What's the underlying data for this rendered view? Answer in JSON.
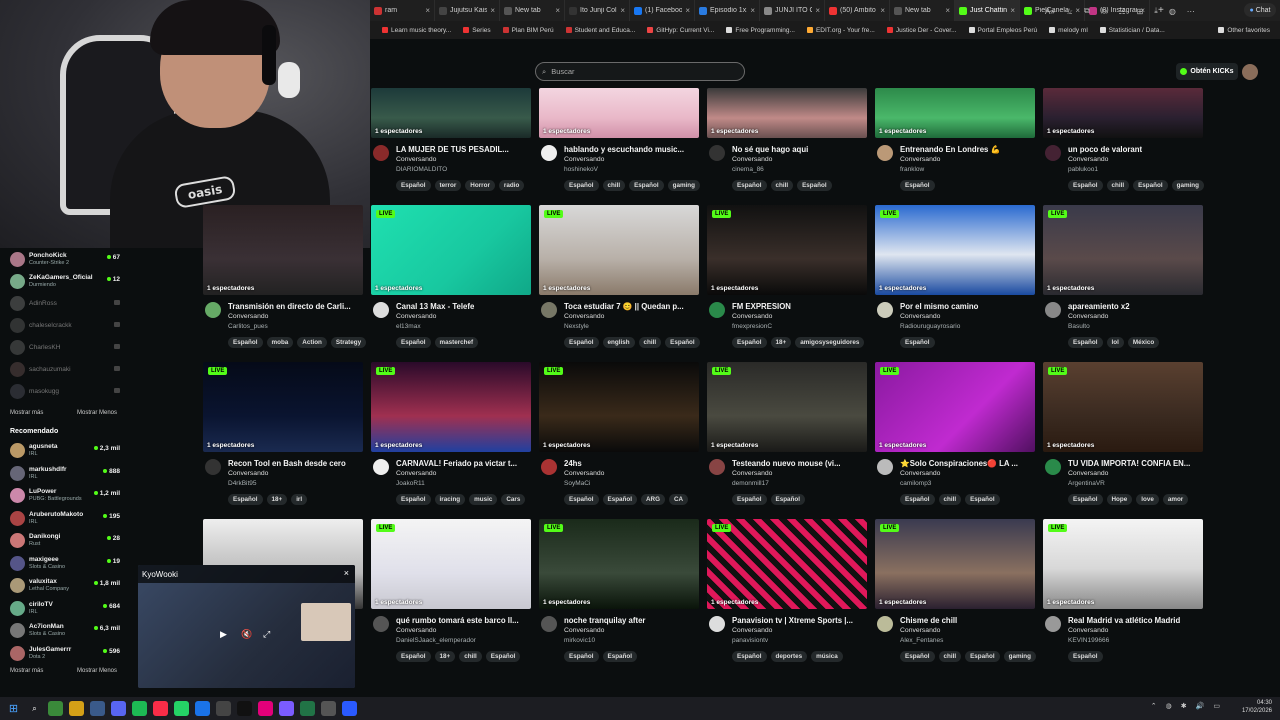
{
  "browser": {
    "tabs": [
      {
        "label": "ram",
        "color": "#c33"
      },
      {
        "label": "Jujutsu Kaisen",
        "color": "#444"
      },
      {
        "label": "New tab",
        "color": "#555"
      },
      {
        "label": "Ito Junji Coll",
        "color": "#333"
      },
      {
        "label": "(1) Facebook",
        "color": "#1877f2"
      },
      {
        "label": "Episodio 1x1",
        "color": "#2a7be0"
      },
      {
        "label": "JUNJI ITO CO",
        "color": "#888"
      },
      {
        "label": "(50) Ambito",
        "color": "#e33"
      },
      {
        "label": "New tab",
        "color": "#555"
      },
      {
        "label": "Just Chatting",
        "color": "#53fc18",
        "active": true
      },
      {
        "label": "PielCanela_21",
        "color": "#53fc18"
      },
      {
        "label": "(3) Instagram",
        "color": "#c13584"
      }
    ],
    "new_tab_symbol": "+",
    "window_controls": [
      "–",
      "▢",
      "✕"
    ],
    "chat_button": "Chat",
    "bookmarks": [
      {
        "label": "Learn music theory...",
        "color": "#e33"
      },
      {
        "label": "Series",
        "color": "#e33"
      },
      {
        "label": "Plan BIM Perú",
        "color": "#c33"
      },
      {
        "label": "Student and Educa...",
        "color": "#c33"
      },
      {
        "label": "GitHyp: Current Vi...",
        "color": "#e44"
      },
      {
        "label": "Free Programming...",
        "color": "#ddd"
      },
      {
        "label": "EDIT.org - Your fre...",
        "color": "#fa3"
      },
      {
        "label": "Justice Der - Cover...",
        "color": "#e33"
      },
      {
        "label": "Portal Empleos Perú",
        "color": "#ddd"
      },
      {
        "label": "melody ml",
        "color": "#ddd"
      },
      {
        "label": "Statistician / Data...",
        "color": "#ddd"
      }
    ],
    "other_favorites": "Other favorites"
  },
  "header": {
    "search_placeholder": "Buscar",
    "get_kicks_label": "Obtén KICKs"
  },
  "sidebar": {
    "following": [
      {
        "name": "PonchoKick",
        "category": "Counter-Strike 2",
        "viewers": "67",
        "color": "#a78",
        "online": true
      },
      {
        "name": "ZeKaGamers_Oficial",
        "category": "Durmiendo",
        "viewers": "12",
        "color": "#7a8",
        "online": true
      },
      {
        "name": "AdinRoss",
        "online": false,
        "color": "#999"
      },
      {
        "name": "chaleselcrackk",
        "online": false,
        "color": "#777"
      },
      {
        "name": "CharlesKH",
        "online": false,
        "color": "#888"
      },
      {
        "name": "sachauzumaki",
        "online": false,
        "color": "#866"
      },
      {
        "name": "masokugg",
        "online": false,
        "color": "#667"
      }
    ],
    "show_more": "Mostrar más",
    "show_less": "Mostrar Menos",
    "recommended_title": "Recomendado",
    "recommended": [
      {
        "name": "agusneta",
        "category": "IRL",
        "viewers": "2,3 mil",
        "color": "#b96"
      },
      {
        "name": "markushdlfr",
        "category": "IRL",
        "viewers": "888",
        "color": "#667"
      },
      {
        "name": "LuPower",
        "category": "PUBG: Battlegrounds",
        "viewers": "1,2 mil",
        "color": "#c8a"
      },
      {
        "name": "AruberutoMakoto",
        "category": "IRL",
        "viewers": "195",
        "color": "#a44"
      },
      {
        "name": "Danikongi",
        "category": "Rust",
        "viewers": "28",
        "color": "#c77"
      },
      {
        "name": "maxigeee",
        "category": "Slots & Casino",
        "viewers": "19",
        "color": "#558"
      },
      {
        "name": "valuxitax",
        "category": "Lethal Company",
        "viewers": "1,8 mil",
        "color": "#a97"
      },
      {
        "name": "ciriloTV",
        "category": "IRL",
        "viewers": "684",
        "color": "#6a8"
      },
      {
        "name": "Ac7ionMan",
        "category": "Slots & Casino",
        "viewers": "6,3 mil",
        "color": "#777"
      },
      {
        "name": "JulesGamerrr",
        "category": "Dota 2",
        "viewers": "596",
        "color": "#a66"
      }
    ]
  },
  "live_badge": "LIVE",
  "streams": [
    {
      "title": "LA MUJER DE TUS PESADIL...",
      "category": "Conversando",
      "user": "DIARIOMALDITO",
      "tags": [
        "Español",
        "terror",
        "Horror",
        "radio"
      ],
      "viewers": "1 espectadores",
      "live": false,
      "thumb": "linear-gradient(180deg,#1d3a3a,#385a4a 60%,#1a2a28)",
      "avatar": "#8a2a2a"
    },
    {
      "title": "hablando y escuchando music...",
      "category": "Conversando",
      "user": "hoshinekoV",
      "tags": [
        "Español",
        "chill",
        "Español",
        "gaming"
      ],
      "viewers": "1 espectadores",
      "live": false,
      "thumb": "linear-gradient(180deg,#f3d5e0,#e9b8c8 60%,#d090a8)",
      "avatar": "#eee"
    },
    {
      "title": "No sé que hago aqui",
      "category": "Conversando",
      "user": "cinema_86",
      "tags": [
        "Español",
        "chill",
        "Español"
      ],
      "viewers": "1 espectadores",
      "live": false,
      "thumb": "linear-gradient(180deg,#3a3a3a,#c08a88 60%,#6a5050)",
      "avatar": "#333"
    },
    {
      "title": "Entrenando En Londres 💪",
      "category": "Conversando",
      "user": "franklow",
      "tags": [
        "Español"
      ],
      "viewers": "1 espectadores",
      "live": false,
      "thumb": "linear-gradient(180deg,#2d8a4a,#4ab86a 60%,#1f6a3a)",
      "avatar": "#b97"
    },
    {
      "title": "un poco de valorant",
      "category": "Conversando",
      "user": "pablukoo1",
      "tags": [
        "Español",
        "chill",
        "Español",
        "gaming"
      ],
      "viewers": "1 espectadores",
      "live": false,
      "thumb": "linear-gradient(180deg,#5a2a3a,#2a2030 60%,#111)",
      "avatar": "#423"
    },
    {
      "title": "Transmisión en directo de Carli...",
      "category": "Conversando",
      "user": "Carlitos_pues",
      "tags": [
        "Español",
        "moba",
        "Action",
        "Strategy"
      ],
      "viewers": "1 espectadores",
      "live": false,
      "thumb": "linear-gradient(180deg,#2a2022,#3a3035 60%,#222)",
      "avatar": "#6a6"
    },
    {
      "title": "Canal 13 Max - Telefe",
      "category": "Conversando",
      "user": "el13max",
      "tags": [
        "Español",
        "masterchef"
      ],
      "viewers": "1 espectadores",
      "live": true,
      "thumb": "linear-gradient(135deg,#1fe0b0,#18c8a0 60%,#10a888)",
      "avatar": "#ddd"
    },
    {
      "title": "Toca estudiar 7 😊 || Quedan p...",
      "category": "Conversando",
      "user": "Nexstyle",
      "tags": [
        "Español",
        "english",
        "chill",
        "Español"
      ],
      "viewers": "1 espectadores",
      "live": true,
      "thumb": "linear-gradient(180deg,#d8d8d8,#b8b0a8 60%,#8a7a6a)",
      "avatar": "#776"
    },
    {
      "title": "FM EXPRESION",
      "category": "Conversando",
      "user": "fmexpresionC",
      "tags": [
        "Español",
        "18+",
        "amigosyseguidores"
      ],
      "viewers": "1 espectadores",
      "live": true,
      "thumb": "linear-gradient(180deg,#111,#3a2f2a 60%,#0a0a0a)",
      "avatar": "#2a8a4a"
    },
    {
      "title": "Por el mismo camino",
      "category": "Conversando",
      "user": "Radiouruguayrosario",
      "tags": [
        "Español"
      ],
      "viewers": "1 espectadores",
      "live": true,
      "thumb": "linear-gradient(180deg,#2a6ad0,#dfe6f0 55%,#1a4aa0)",
      "avatar": "#ccb"
    },
    {
      "title": "apareamiento x2",
      "category": "Conversando",
      "user": "Basulto",
      "tags": [
        "Español",
        "lol",
        "México"
      ],
      "viewers": "1 espectadores",
      "live": true,
      "thumb": "linear-gradient(180deg,#3a3a4a,#5a4a4a 60%,#2a2a30)",
      "avatar": "#888"
    },
    {
      "title": "Recon Tool en Bash desde cero",
      "category": "Conversando",
      "user": "D4rkBit95",
      "tags": [
        "Español",
        "18+",
        "irl"
      ],
      "viewers": "1 espectadores",
      "live": true,
      "thumb": "linear-gradient(180deg,#050a18,#0a1430 60%,#1a2a50)",
      "avatar": "#333"
    },
    {
      "title": "CARNAVAL! Feriado pa victar t...",
      "category": "Conversando",
      "user": "JoakoR11",
      "tags": [
        "Español",
        "iracing",
        "music",
        "Cars"
      ],
      "viewers": "1 espectadores",
      "live": true,
      "thumb": "linear-gradient(180deg,#2a0a2a,#a03050 60%,#2040a0)",
      "avatar": "#eee"
    },
    {
      "title": "24hs",
      "category": "Conversando",
      "user": "SoyMaCi",
      "tags": [
        "Español",
        "Español",
        "ARG",
        "CA"
      ],
      "viewers": "1 espectadores",
      "live": true,
      "thumb": "linear-gradient(180deg,#0a0a0a,#3a2a1a 60%,#0a0a0a)",
      "avatar": "#a33"
    },
    {
      "title": "Testeando nuevo mouse (vi...",
      "category": "Conversando",
      "user": "demonmill17",
      "tags": [
        "Español",
        "Español"
      ],
      "viewers": "1 espectadores",
      "live": true,
      "thumb": "linear-gradient(180deg,#2a2a28,#4a4a40 60%,#1a1a18)",
      "avatar": "#844"
    },
    {
      "title": "⭐Solo Conspiraciones🔴 LA ...",
      "category": "Conversando",
      "user": "camilomp3",
      "tags": [
        "Español",
        "chill",
        "Español"
      ],
      "viewers": "1 espectadores",
      "live": true,
      "thumb": "linear-gradient(135deg,#8a1aa0,#c02ad0 60%,#501060)",
      "avatar": "#bbb"
    },
    {
      "title": "TU VIDA IMPORTA! CONFIA EN...",
      "category": "Conversando",
      "user": "ArgentinaVR",
      "tags": [
        "Español",
        "Hope",
        "love",
        "amor"
      ],
      "viewers": "1 espectadores",
      "live": true,
      "thumb": "linear-gradient(180deg,#5a4030,#3a2a20 60%,#2a1a10)",
      "avatar": "#2a8a4a"
    },
    {
      "title": "",
      "category": "",
      "user": "",
      "tags": [],
      "viewers": "",
      "live": false,
      "thumb": "linear-gradient(180deg,#eee,#bbb 60%,#333)",
      "avatar": "#0b0e0f"
    },
    {
      "title": "qué rumbo tomará este barco ll...",
      "category": "Conversando",
      "user": "DanielSJaack_elemperador",
      "tags": [
        "Español",
        "18+",
        "chill",
        "Español"
      ],
      "viewers": "1 espectadores",
      "live": true,
      "thumb": "linear-gradient(180deg,#f4f4f4,#e0e0ea 60%,#c8c8d0)",
      "avatar": "#555"
    },
    {
      "title": "noche tranquilay after",
      "category": "Conversando",
      "user": "mirkovic10",
      "tags": [
        "Español",
        "Español"
      ],
      "viewers": "1 espectadores",
      "live": true,
      "thumb": "linear-gradient(180deg,#1a2a1a,#3a4a3a 60%,#0a140a)",
      "avatar": "#555"
    },
    {
      "title": "Panavision tv | Xtreme Sports |...",
      "category": "Conversando",
      "user": "panavisiontv",
      "tags": [
        "Español",
        "deportes",
        "música"
      ],
      "viewers": "1 espectadores",
      "live": true,
      "thumb": "repeating-linear-gradient(45deg,#e0185a 0 6px,#111 6px 12px)",
      "avatar": "#ddd"
    },
    {
      "title": "Chisme de chill",
      "category": "Conversando",
      "user": "Alex_Fentanes",
      "tags": [
        "Español",
        "chill",
        "Español",
        "gaming"
      ],
      "viewers": "1 espectadores",
      "live": true,
      "thumb": "linear-gradient(180deg,#3a3a50,#8a7060 60%,#2a2030)",
      "avatar": "#bb9"
    },
    {
      "title": "Real Madrid va atlético Madrid",
      "category": "Conversando",
      "user": "KEVIN199666",
      "tags": [
        "Español"
      ],
      "viewers": "1 espectadores",
      "live": true,
      "thumb": "linear-gradient(180deg,#f4f4f4,#d8d8d8 55%,#888)",
      "avatar": "#999"
    }
  ],
  "miniplayer": {
    "title": "KyoWooki",
    "close": "×",
    "play": "▶",
    "mute": "🔇",
    "expand": "⤢"
  },
  "taskbar": {
    "time": "04:30",
    "date": "17/02/2026"
  },
  "webcam": {
    "shirt_text": "oasis"
  }
}
